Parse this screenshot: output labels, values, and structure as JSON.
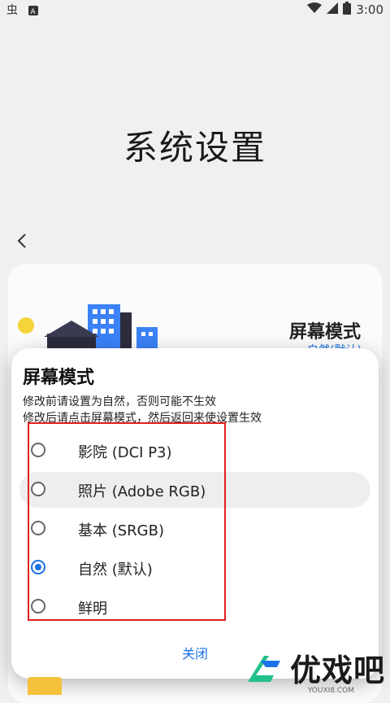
{
  "status_bar": {
    "time": "3:00",
    "left_icons": [
      "bug-icon",
      "font-a-icon"
    ],
    "right_icons": [
      "wifi-icon",
      "signal-icon",
      "battery-icon"
    ]
  },
  "page": {
    "title": "系统设置"
  },
  "background_card": {
    "title": "屏幕模式",
    "subtitle": "自然(默认)"
  },
  "dialog": {
    "title": "屏幕模式",
    "desc_line1": "修改前请设置为自然，否则可能不生效",
    "desc_line2": "修改后请点击屏幕模式，然后返回来使设置生效",
    "options": [
      {
        "label": "影院 (DCI P3)",
        "checked": false
      },
      {
        "label": "照片 (Adobe RGB)",
        "checked": false
      },
      {
        "label": "基本 (SRGB)",
        "checked": false
      },
      {
        "label": "自然 (默认)",
        "checked": true
      },
      {
        "label": "鲜明",
        "checked": false
      }
    ],
    "close_label": "关闭"
  },
  "watermark": {
    "text": "优戏吧",
    "url": "YOUXI8.COM"
  },
  "colors": {
    "accent": "#1a73e8",
    "highlight_box": "#e02020"
  }
}
